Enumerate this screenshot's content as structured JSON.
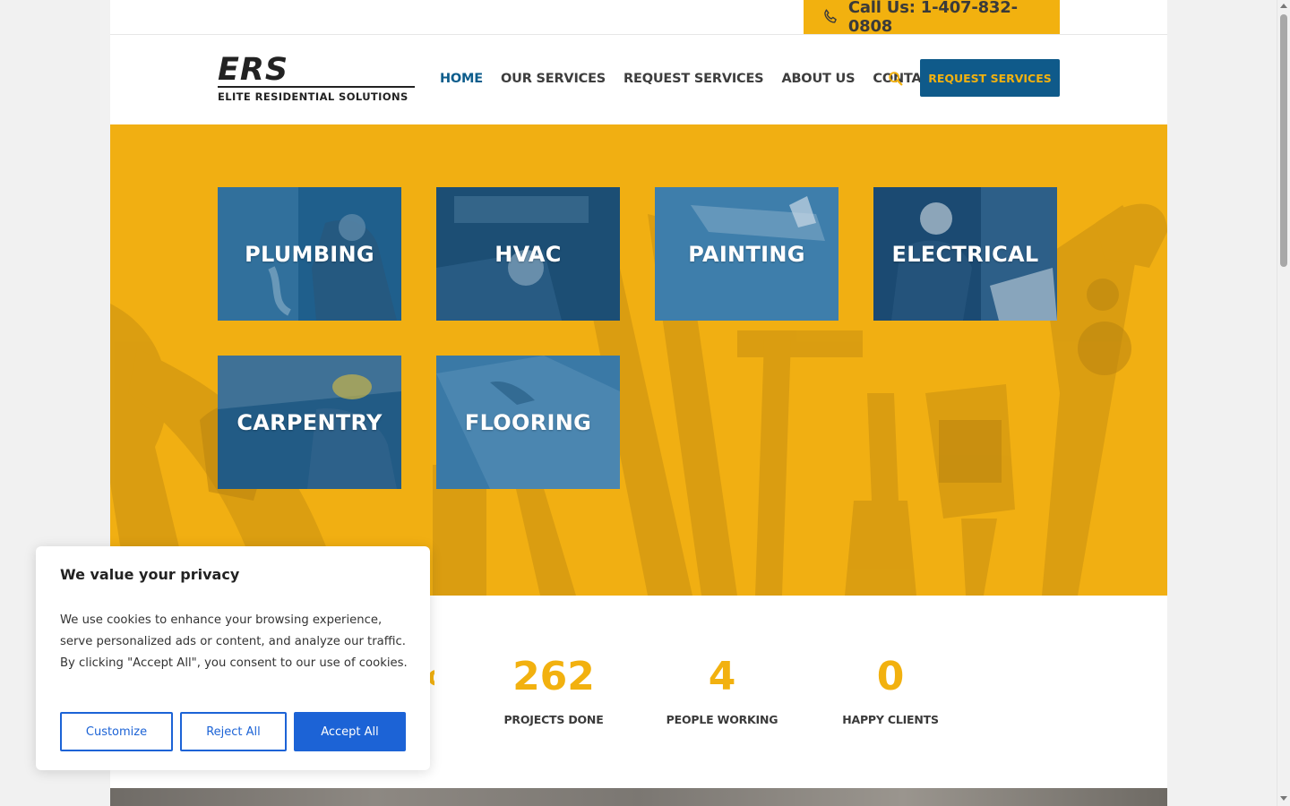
{
  "topbar": {
    "phone_icon": "phone-icon",
    "call_text": "Call Us: 1-407-832-0808"
  },
  "header": {
    "logo_mark": "ERS",
    "logo_sub": "ELITE RESIDENTIAL SOLUTIONS",
    "nav": [
      {
        "label": "HOME",
        "active": true
      },
      {
        "label": "OUR SERVICES",
        "active": false
      },
      {
        "label": "REQUEST SERVICES",
        "active": false
      },
      {
        "label": "ABOUT US",
        "active": false
      },
      {
        "label": "CONTACTS",
        "active": false
      }
    ],
    "search_icon": "search-icon",
    "cta_label": "REQUEST SERVICES"
  },
  "services": [
    {
      "label": "PLUMBING"
    },
    {
      "label": "HVAC"
    },
    {
      "label": "PAINTING"
    },
    {
      "label": "ELECTRICAL"
    },
    {
      "label": "CARPENTRY"
    },
    {
      "label": "FLOORING"
    }
  ],
  "stats": [
    {
      "value": "262",
      "label": "PROJECTS DONE"
    },
    {
      "value": "4",
      "label": "PEOPLE WORKING"
    },
    {
      "value": "0",
      "label": "HAPPY CLIENTS"
    }
  ],
  "cookie": {
    "title": "We value your privacy",
    "body": "We use cookies to enhance your browsing experience, serve personalized ads or content, and analyze our traffic. By clicking \"Accept All\", you consent to our use of cookies.",
    "customize": "Customize",
    "reject": "Reject All",
    "accept": "Accept All"
  },
  "colors": {
    "brand_yellow": "#f2b10f",
    "brand_blue": "#0f5a8a",
    "cookie_blue": "#1c63d6"
  }
}
